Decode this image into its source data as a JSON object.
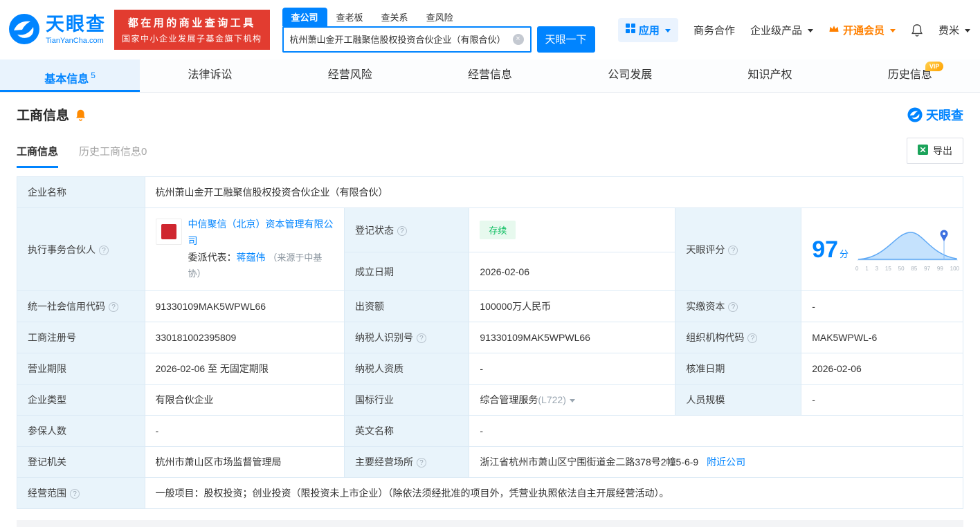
{
  "brand": {
    "name": "天眼查",
    "domain": "TianYanCha.com"
  },
  "colors": {
    "primary_blue": "#0084FF",
    "banner_red": "#E23C30",
    "vip_orange": "#FF8000",
    "status_green": "#10BF63",
    "label_cell_bg": "#E9F4FB"
  },
  "banner": {
    "line1": "都在用的商业查询工具",
    "line2": "国家中小企业发展子基金旗下机构"
  },
  "search": {
    "tabs": [
      {
        "label": "查公司"
      },
      {
        "label": "查老板"
      },
      {
        "label": "查关系"
      },
      {
        "label": "查风险"
      }
    ],
    "value": "杭州萧山金开工融聚信股权投资合伙企业（有限合伙）",
    "button_label": "天眼一下"
  },
  "header_menu": {
    "apps": "应用",
    "cooperation": "商务合作",
    "enterprise_products": "企业级产品",
    "vip": "开通会员",
    "user": "费米"
  },
  "nav": {
    "tabs": [
      {
        "label": "基本信息",
        "badge": "5"
      },
      {
        "label": "法律诉讼"
      },
      {
        "label": "经营风险"
      },
      {
        "label": "经营信息"
      },
      {
        "label": "公司发展"
      },
      {
        "label": "知识产权"
      },
      {
        "label": "历史信息",
        "vip_tag": "VIP"
      }
    ]
  },
  "section": {
    "title": "工商信息",
    "tabs": [
      {
        "label": "工商信息"
      },
      {
        "label": "历史工商信息0"
      }
    ],
    "export_label": "导出"
  },
  "table": {
    "rows": {
      "company_name": {
        "label": "企业名称",
        "value": "杭州萧山金开工融聚信股权投资合伙企业（有限合伙）"
      },
      "partner": {
        "label": "执行事务合伙人",
        "company": "中信聚信（北京）资本管理有限公司",
        "rep_label": "委派代表：",
        "rep_name": "蒋蕴伟",
        "rep_source": "（来源于中基协）"
      },
      "reg_status": {
        "label": "登记状态",
        "value": "存续"
      },
      "establish_date": {
        "label": "成立日期",
        "value": "2026-02-06"
      },
      "score": {
        "label": "天眼评分",
        "value": "97",
        "unit": "分"
      },
      "credit_code": {
        "label": "统一社会信用代码",
        "value": "91330109MAK5WPWL66"
      },
      "capital": {
        "label": "出资额",
        "value": "100000万人民币"
      },
      "paid_capital": {
        "label": "实缴资本",
        "value": "-"
      },
      "reg_number": {
        "label": "工商注册号",
        "value": "330181002395809"
      },
      "taxpayer_id": {
        "label": "纳税人识别号",
        "value": "91330109MAK5WPWL66"
      },
      "org_code": {
        "label": "组织机构代码",
        "value": "MAK5WPWL-6"
      },
      "term": {
        "label": "营业期限",
        "value": "2026-02-06 至 无固定期限"
      },
      "taxpayer_quality": {
        "label": "纳税人资质",
        "value": "-"
      },
      "approval_date": {
        "label": "核准日期",
        "value": "2026-02-06"
      },
      "company_type": {
        "label": "企业类型",
        "value": "有限合伙企业"
      },
      "industry": {
        "label": "国标行业",
        "value": "综合管理服务",
        "code": "(L722)"
      },
      "staff_size": {
        "label": "人员规模",
        "value": "-"
      },
      "insured_count": {
        "label": "参保人数",
        "value": "-"
      },
      "english_name": {
        "label": "英文名称",
        "value": "-"
      },
      "reg_authority": {
        "label": "登记机关",
        "value": "杭州市萧山区市场监督管理局"
      },
      "address": {
        "label": "主要经营场所",
        "value": "浙江省杭州市萧山区宁围街道金二路378号2幢5-6-9",
        "nearby": "附近公司"
      },
      "business_scope": {
        "label": "经营范围",
        "value": "一般项目：股权投资；创业投资（限投资未上市企业）（除依法须经批准的项目外，凭营业执照依法自主开展经营活动）。"
      }
    }
  },
  "chart_data": {
    "type": "area",
    "x_ticks": [
      "0",
      "1",
      "3",
      "15",
      "50",
      "85",
      "97",
      "99",
      "100"
    ],
    "marker_value": 97
  }
}
